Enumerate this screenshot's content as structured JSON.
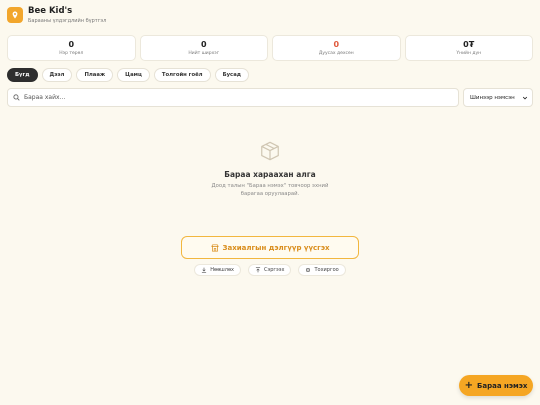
{
  "header": {
    "title": "Bee Kid's",
    "subtitle": "Барааны үлдэгдлийн бүртгэл"
  },
  "stats": [
    {
      "value": "0",
      "label": "Нэр төрөл"
    },
    {
      "value": "0",
      "label": "Нийт ширхэг"
    },
    {
      "value": "0",
      "label": "Дуусах дөхсөн"
    },
    {
      "value": "0₮",
      "label": "Үнийн дүн"
    }
  ],
  "tabs": [
    "Бүгд",
    "Дээл",
    "Плааж",
    "Цамц",
    "Толгойн гоёл",
    "Бусад"
  ],
  "search": {
    "placeholder": "Бараа хайх..."
  },
  "sort": {
    "selected": "Шинээр нэмсэн"
  },
  "empty_state": {
    "title": "Бараа хараахан алга",
    "description": "Доод талын \"Бараа нэмэх\" товчоор эхний барагаа оруулаарай."
  },
  "order_button": {
    "label": "Захиалгын дэлгүүр үүсгэх"
  },
  "small_actions": {
    "import": "Нөөшлөх",
    "restore": "Сэргээх",
    "settings": "Тохиргоо"
  },
  "fab": {
    "label": "Бараа нэмэх"
  },
  "colors": {
    "accent": "#f5a623",
    "background": "#fcf9ef",
    "warning": "#e05a3d"
  }
}
